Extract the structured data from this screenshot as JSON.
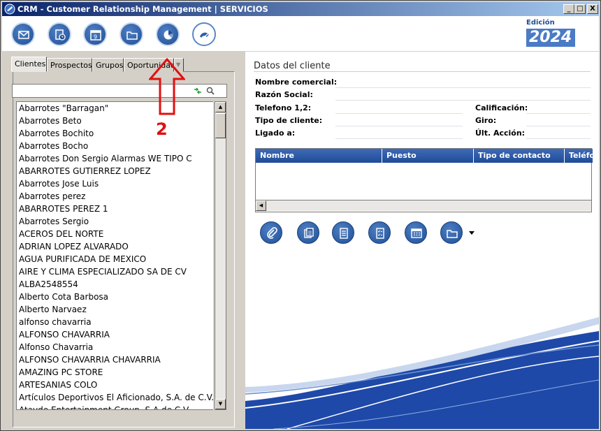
{
  "window": {
    "title": "CRM - Customer Relationship Management | SERVICIOS",
    "minimize": "_",
    "maximize": "□",
    "close": "X"
  },
  "toolbar": {
    "buttons": [
      {
        "icon": "envelope-list-icon"
      },
      {
        "icon": "document-clock-icon"
      },
      {
        "icon": "calendar-icon",
        "text": "9"
      },
      {
        "icon": "folder-icon"
      },
      {
        "icon": "pie-chart-icon"
      },
      {
        "icon": "handshake-icon"
      }
    ],
    "edition_label": "Edición",
    "edition_year": "2024"
  },
  "tabs": [
    {
      "label": "Clientes",
      "active": true
    },
    {
      "label": "Prospectos"
    },
    {
      "label": "Grupos"
    },
    {
      "label": "Oportunidad"
    }
  ],
  "search": {
    "value": "",
    "placeholder": ""
  },
  "clients": [
    "Abarrotes \"Barragan\"",
    "Abarrotes Beto",
    "Abarrotes Bochito",
    "Abarrotes Bocho",
    "Abarrotes Don Sergio Alarmas WE TIPO C",
    "ABARROTES GUTIERREZ LOPEZ",
    "Abarrotes Jose Luis",
    "Abarrotes perez",
    "ABARROTES PEREZ 1",
    "Abarrotes Sergio",
    "ACEROS DEL NORTE",
    "ADRIAN LOPEZ ALVARADO",
    "AGUA PURIFICADA DE MEXICO",
    "AIRE Y CLIMA ESPECIALIZADO SA DE CV",
    "ALBA2548554",
    "Alberto Cota Barbosa",
    "Alberto Narvaez",
    "alfonso chavarria",
    "ALFONSO CHAVARRIA",
    "Alfonso Chavarria",
    "ALFONSO CHAVARRIA CHAVARRIA",
    "AMAZING PC STORE",
    "ARTESANIAS COLO",
    "Artículos Deportivos El Aficionado, S.A. de C.V.",
    "Atayde Entertainment Group, S.A de C.V."
  ],
  "details": {
    "section_title": "Datos del cliente",
    "labels": {
      "nombre_comercial": "Nombre comercial:",
      "razon_social": "Razón Social:",
      "telefono": "Telefono 1,2:",
      "tipo_cliente": "Tipo de cliente:",
      "ligado": "Ligado a:",
      "calificacion": "Calificación:",
      "giro": "Giro:",
      "ult_accion": "Últ. Acción:"
    }
  },
  "contacts_grid": {
    "columns": [
      "Nombre",
      "Puesto",
      "Tipo de contacto",
      "Teléfo"
    ]
  },
  "actions": {
    "icons": [
      "paperclip-icon",
      "documents-icon",
      "notes-icon",
      "checklist-icon",
      "calendar-grid-icon",
      "folder-dropdown-icon"
    ]
  },
  "annotation": {
    "number": "2",
    "color": "#e01010"
  }
}
